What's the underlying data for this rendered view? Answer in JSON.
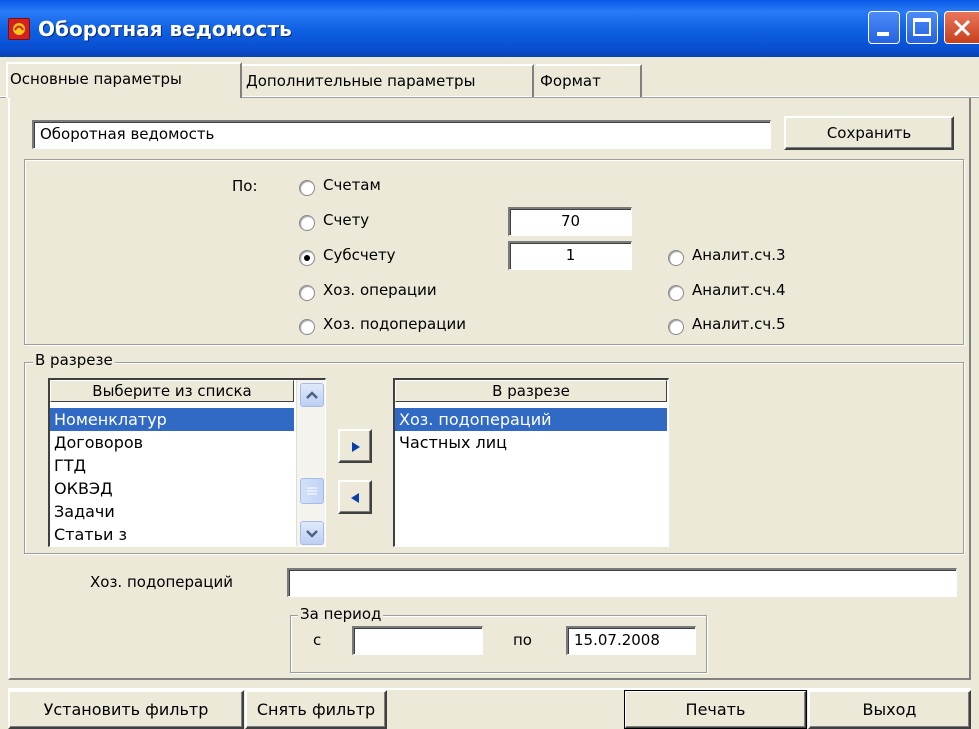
{
  "window": {
    "title": "Оборотная ведомость"
  },
  "tabs": [
    {
      "label": "Основные параметры"
    },
    {
      "label": "Дополнительные параметры"
    },
    {
      "label": "Формат"
    }
  ],
  "report": {
    "name_value": "Оборотная ведомость",
    "save_label": "Сохранить"
  },
  "by": {
    "label": "По:",
    "options": [
      {
        "label": "Счетам",
        "selected": false
      },
      {
        "label": "Счету",
        "selected": false
      },
      {
        "label": "Субсчету",
        "selected": true
      },
      {
        "label": "Хоз. операции",
        "selected": false
      },
      {
        "label": "Хоз. подоперации",
        "selected": false
      }
    ],
    "account_value": "70",
    "subaccount_value": "1",
    "analytic_options": [
      {
        "label": "Аналит.сч.3",
        "selected": false
      },
      {
        "label": "Аналит.сч.4",
        "selected": false
      },
      {
        "label": "Аналит.сч.5",
        "selected": false
      }
    ]
  },
  "breakdown": {
    "group_label": "В разрезе",
    "available_header": "Выберите из списка",
    "available_items": [
      "Номенклатур",
      "Договоров",
      "ГТД",
      "ОКВЭД",
      "Задачи",
      "Статьи з"
    ],
    "available_selected_index": 0,
    "selected_header": "В разрезе",
    "selected_items": [
      "Хоз. подопераций",
      "Частных лиц"
    ],
    "selected_selected_index": 0,
    "add_icon": "arrow-right-icon",
    "remove_icon": "arrow-left-icon"
  },
  "filter": {
    "label": "Хоз. подопераций",
    "value": ""
  },
  "period": {
    "group_label": "За период",
    "from_label": "с",
    "from_value": "",
    "to_label": "по",
    "to_value": "15.07.2008"
  },
  "footer": {
    "set_filter_label": "Установить фильтр",
    "clear_filter_label": "Снять фильтр",
    "print_label": "Печать",
    "exit_label": "Выход"
  },
  "colors": {
    "titlebar": "#0a5fe2",
    "selection": "#316ac5",
    "surface": "#ece9d8"
  }
}
